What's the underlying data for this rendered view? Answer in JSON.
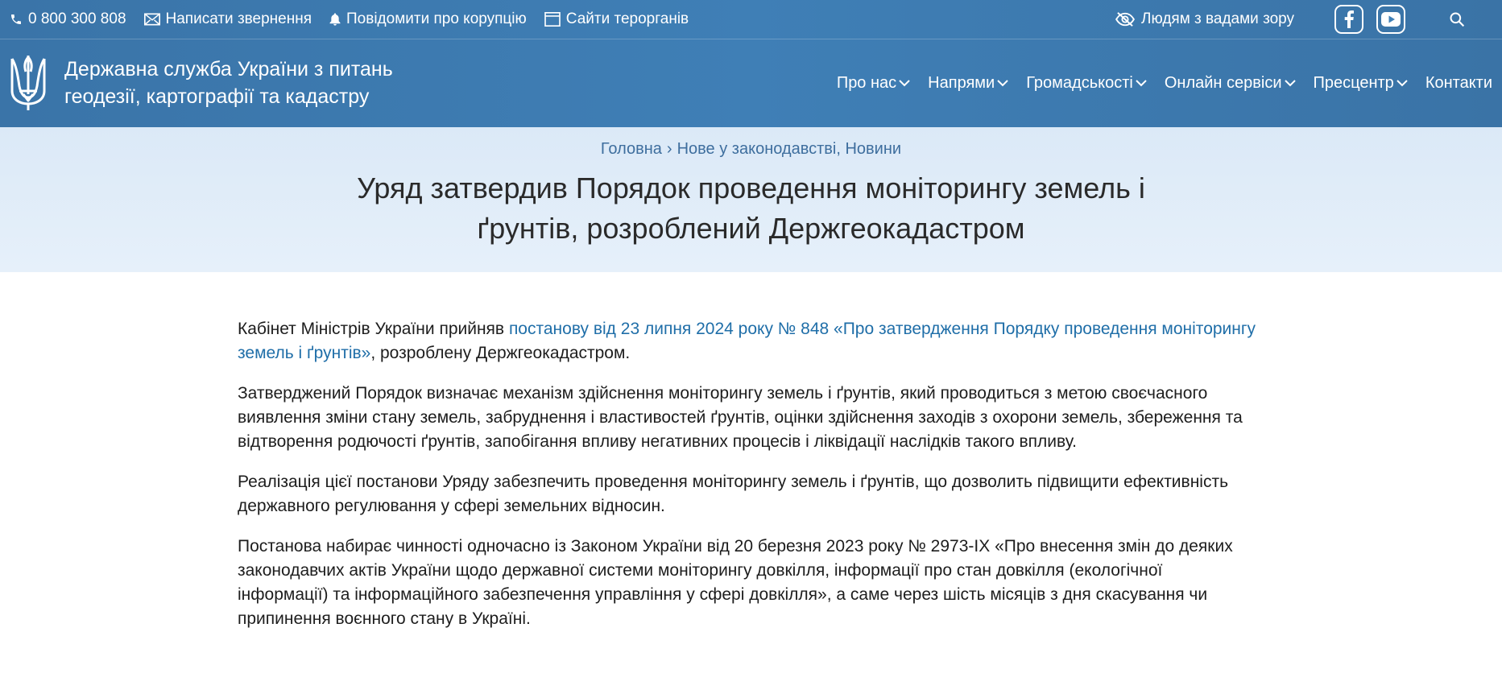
{
  "topbar": {
    "phone": "0 800 300 808",
    "write_appeal": "Написати звернення",
    "report_corruption": "Повідомити про корупцію",
    "territorial_sites": "Сайти терорганів",
    "vision_impaired": "Людям з вадами зору",
    "icons": [
      "phone-icon",
      "mail-icon",
      "bell-icon",
      "window-icon",
      "eye-slash-icon",
      "facebook-icon",
      "youtube-icon",
      "search-icon"
    ]
  },
  "header": {
    "logo_line1": "Державна служба України з питань",
    "logo_line2": "геодезії, картографії та кадастру"
  },
  "nav": {
    "items": [
      {
        "label": "Про нас"
      },
      {
        "label": "Напрями"
      },
      {
        "label": "Громадськості"
      },
      {
        "label": "Онлайн сервіси"
      },
      {
        "label": "Пресцентр"
      },
      {
        "label": "Контакти"
      }
    ]
  },
  "breadcrumb": {
    "home": "Головна",
    "separator": "›",
    "category_1": "Нове у законодавстві",
    "category_2": "Новини"
  },
  "article": {
    "title_line1": "Уряд затвердив Порядок проведення моніторингу земель і",
    "title_line2": "ґрунтів, розроблений Держгеокадастром",
    "p1_before": "Кабінет Міністрів України прийняв ",
    "p1_link": "постанову від 23 липня 2024 року № 848 «Про затвердження Порядку проведення моніторингу земель і ґрунтів»",
    "p1_after": ", розроблену Держгеокадастром.",
    "p2": "Затверджений Порядок визначає механізм здійснення моніторингу земель і ґрунтів, який проводиться з метою своєчасного виявлення зміни стану земель, забруднення і властивостей ґрунтів, оцінки здійснення заходів з охорони земель, збереження та відтворення родючості ґрунтів, запобігання впливу негативних процесів і ліквідації наслідків такого впливу.",
    "p3": "Реалізація цієї постанови Уряду забезпечить проведення моніторингу земель і ґрунтів, що дозволить підвищити ефективність державного регулювання у сфері земельних відносин.",
    "p4": "Постанова набирає чинності одночасно із Законом України від 20 березня 2023 року № 2973-IX «Про внесення змін до деяких законодавчих актів України щодо державної системи моніторингу довкілля, інформації про стан довкілля (екологічної інформації) та інформаційного забезпечення управління у сфері довкілля», а саме через шість місяців з дня скасування чи припинення воєнного стану в Україні."
  },
  "colors": {
    "header_bg": "#3f7fb6",
    "hero_bg": "#e2edf8",
    "link": "#1f6ea8",
    "breadcrumb": "#3e6e9e"
  }
}
